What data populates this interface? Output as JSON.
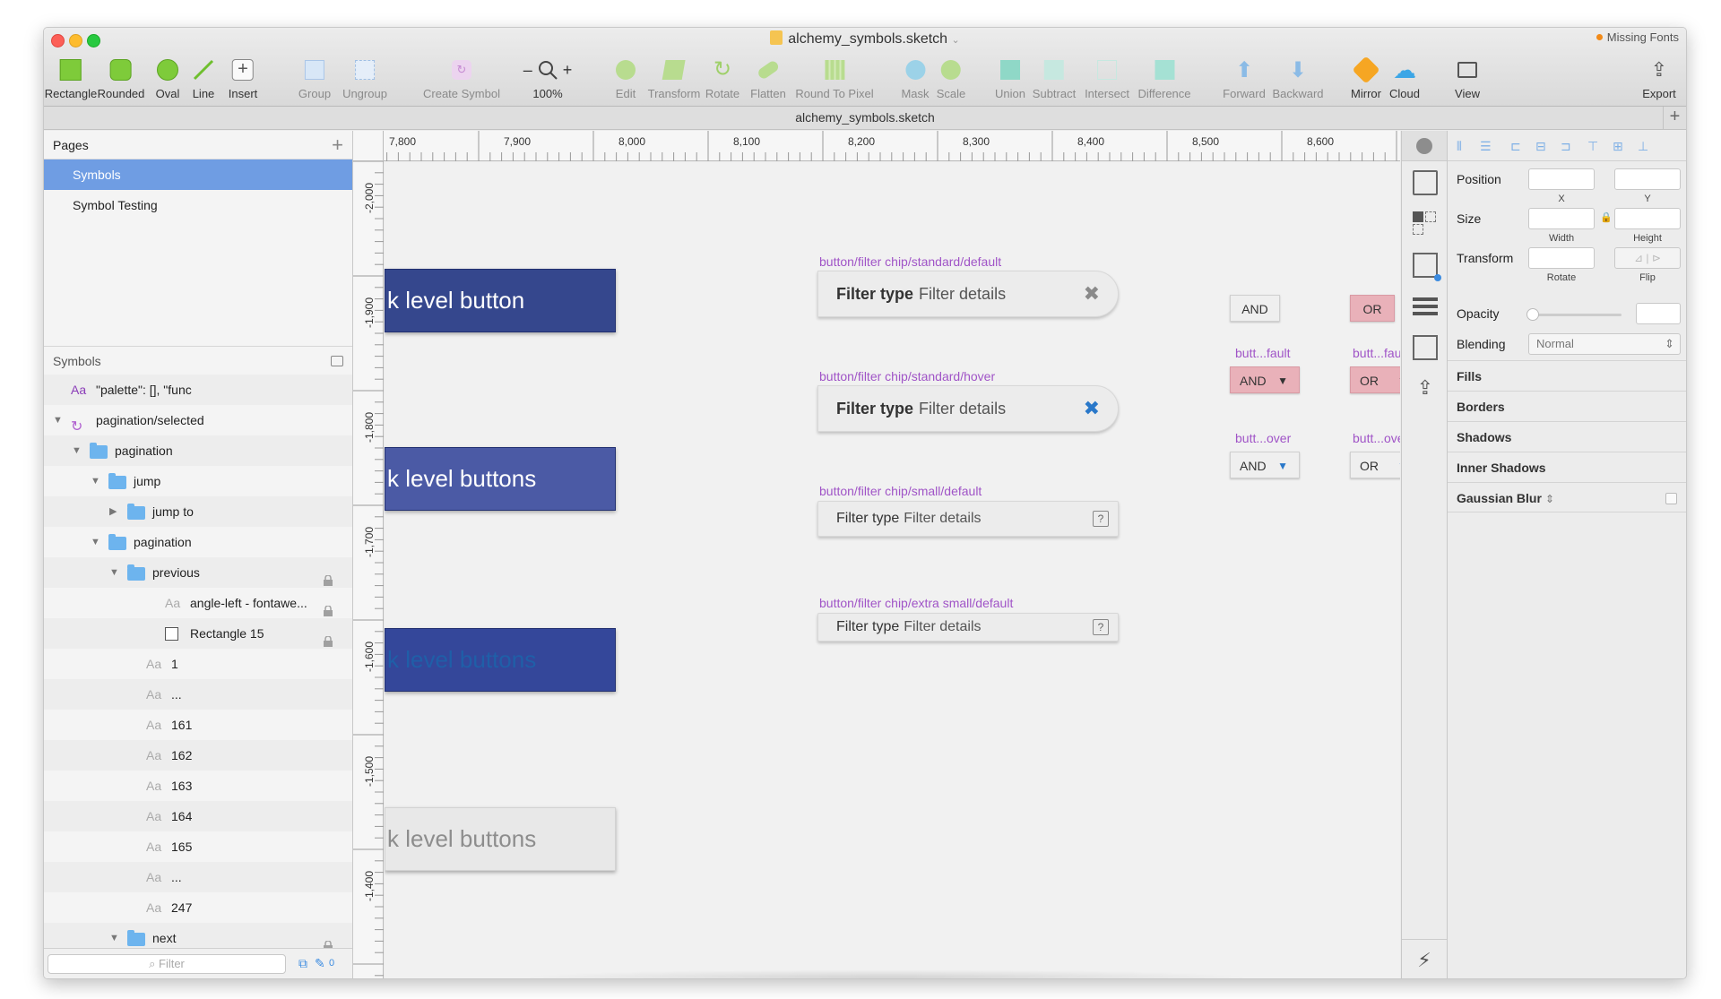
{
  "window": {
    "title": "alchemy_symbols.sketch",
    "missing_fonts": "Missing Fonts",
    "tab_title": "alchemy_symbols.sketch"
  },
  "toolbar": {
    "rectangle": "Rectangle",
    "rounded": "Rounded",
    "oval": "Oval",
    "line": "Line",
    "insert": "Insert",
    "group": "Group",
    "ungroup": "Ungroup",
    "create_symbol": "Create Symbol",
    "zoom": "100%",
    "edit": "Edit",
    "transform": "Transform",
    "rotate": "Rotate",
    "flatten": "Flatten",
    "round_to_pixel": "Round To Pixel",
    "mask": "Mask",
    "scale": "Scale",
    "union": "Union",
    "subtract": "Subtract",
    "intersect": "Intersect",
    "difference": "Difference",
    "forward": "Forward",
    "backward": "Backward",
    "mirror": "Mirror",
    "cloud": "Cloud",
    "view": "View",
    "export": "Export"
  },
  "pages": {
    "header": "Pages",
    "items": [
      "Symbols",
      "Symbol Testing"
    ]
  },
  "symbols": {
    "header": "Symbols",
    "layers": [
      {
        "kind": "text",
        "label": "\"palette\": [], \"func"
      },
      {
        "kind": "symbol",
        "label": "pagination/selected"
      },
      {
        "kind": "folder",
        "label": "pagination"
      },
      {
        "kind": "folder",
        "label": "jump"
      },
      {
        "kind": "folder",
        "label": "jump to"
      },
      {
        "kind": "folder",
        "label": "pagination"
      },
      {
        "kind": "folder",
        "label": "previous"
      },
      {
        "kind": "text",
        "label": "angle-left - fontawe..."
      },
      {
        "kind": "rect",
        "label": "Rectangle 15"
      },
      {
        "kind": "text",
        "label": "1"
      },
      {
        "kind": "text",
        "label": "..."
      },
      {
        "kind": "text",
        "label": "161"
      },
      {
        "kind": "text",
        "label": "162"
      },
      {
        "kind": "text",
        "label": "163"
      },
      {
        "kind": "text",
        "label": "164"
      },
      {
        "kind": "text",
        "label": "165"
      },
      {
        "kind": "text",
        "label": "..."
      },
      {
        "kind": "text",
        "label": "247"
      },
      {
        "kind": "folder",
        "label": "next"
      }
    ],
    "text_icon": "Aa",
    "filter_placeholder": "Filter",
    "filter_count": "0"
  },
  "ruler": {
    "h": [
      "7,800",
      "7,900",
      "8,000",
      "8,100",
      "8,200",
      "8,300",
      "8,400",
      "8,500",
      "8,600"
    ],
    "v": [
      "-2,000",
      "-1,900",
      "-1,800",
      "-1,700",
      "-1,600",
      "-1,500",
      "-1,400"
    ]
  },
  "canvas": {
    "big_buttons": [
      "k level button",
      "k level buttons",
      "k level buttons",
      "k level buttons"
    ],
    "chip_labels": [
      "button/filter chip/standard/default",
      "button/filter chip/standard/hover",
      "button/filter chip/small/default",
      "button/filter chip/extra small/default"
    ],
    "chip_type": "Filter type",
    "chip_details": "Filter details",
    "and": "AND",
    "or": "OR",
    "fault_label": "butt...fault",
    "over_label": "butt...over",
    "q": "?"
  },
  "inspector": {
    "position": "Position",
    "x": "X",
    "y": "Y",
    "size": "Size",
    "width": "Width",
    "height": "Height",
    "transform": "Transform",
    "rotate": "Rotate",
    "flip": "Flip",
    "opacity": "Opacity",
    "blending": "Blending",
    "blending_value": "Normal",
    "fills": "Fills",
    "borders": "Borders",
    "shadows": "Shadows",
    "inner_shadows": "Inner Shadows",
    "gaussian_blur": "Gaussian Blur"
  },
  "colors": {
    "selection": "#6f9de3",
    "symbol_purple": "#a054c7",
    "button_navy": "#35478d",
    "chip_close_blue": "#2a78c9",
    "pink_button": "#e9b1b9"
  }
}
